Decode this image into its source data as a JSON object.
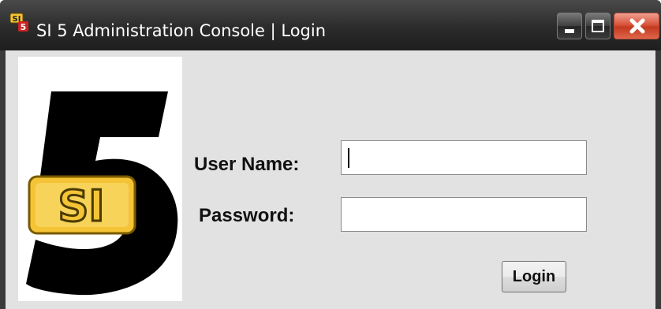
{
  "window": {
    "title": "SI 5 Administration Console | Login",
    "icon": "si5-app-icon",
    "controls": [
      "minimize-icon",
      "maximize-icon",
      "close-icon"
    ]
  },
  "logo": {
    "number": "5",
    "badge_text": "SI",
    "colors": {
      "number": "#000000",
      "badge": "#f4c436"
    }
  },
  "form": {
    "username_label": "User Name:",
    "username_value": "",
    "password_label": "Password:",
    "password_value": "",
    "login_label": "Login"
  },
  "colors": {
    "client_bg": "#e2e2e2",
    "close_button": "#d9533b"
  }
}
